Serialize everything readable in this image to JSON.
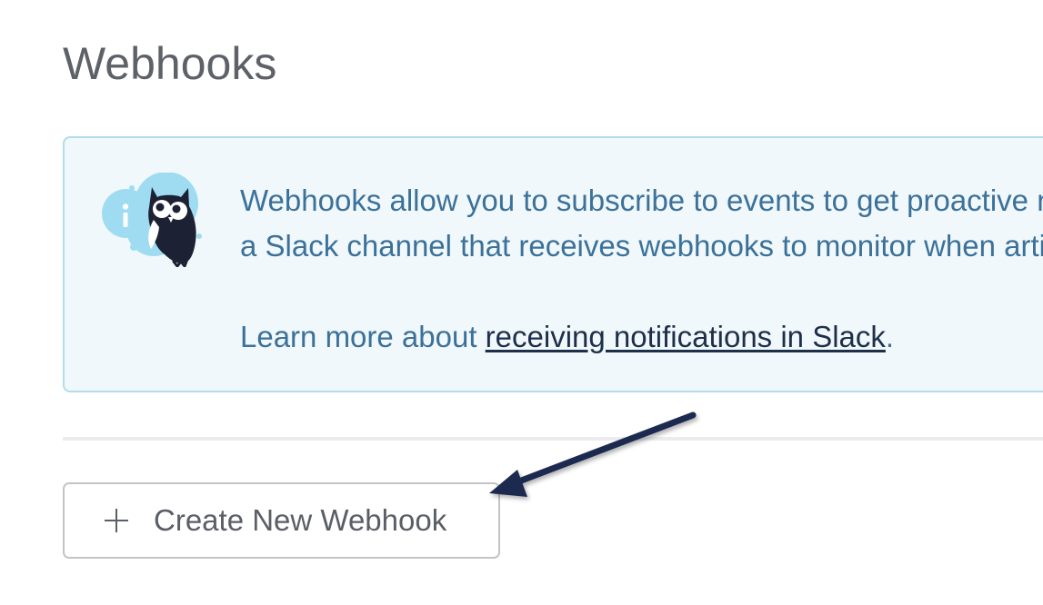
{
  "page": {
    "title": "Webhooks"
  },
  "info": {
    "line1": "Webhooks allow you to subscribe to events to get proactive notifications about changes to your knowledge base. For example, you could set up",
    "line2": "a Slack channel that receives webhooks to monitor when articles are published or updated.",
    "learn_prefix": "Learn more about ",
    "learn_link": "receiving notifications in Slack",
    "learn_suffix": ".",
    "icon": "owl-mascot-icon",
    "accent_color": "#3c7199",
    "background_color": "#f0f8fb"
  },
  "actions": {
    "create_label": "Create New Webhook",
    "create_icon": "plus-icon"
  },
  "annotation": {
    "arrow_color": "#1e2a4f"
  }
}
